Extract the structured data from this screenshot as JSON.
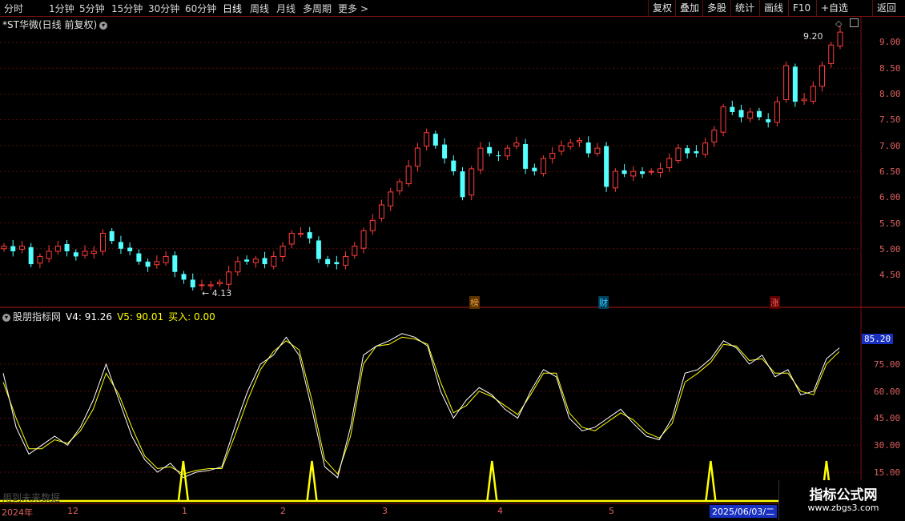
{
  "toolbar": {
    "periods": [
      "分时",
      "1分钟",
      "5分钟",
      "15分钟",
      "30分钟",
      "60分钟",
      "日线",
      "周线",
      "月线",
      "多周期",
      "更多 >"
    ],
    "active_period": "日线",
    "right_buttons": [
      "复权",
      "叠加",
      "多股",
      "统计",
      "画线",
      "F10",
      "+自选",
      "返回"
    ]
  },
  "stock": {
    "title": "*ST华微(日线 前复权)",
    "high_label": "9.20",
    "low_label": "4.13"
  },
  "indicator": {
    "name": "股朋指标网",
    "v4": "V4: 91.26",
    "v5": "V5: 90.01",
    "buy": "买入: 0.00",
    "current_value": "85.20"
  },
  "price_axis": [
    "9.00",
    "8.50",
    "8.00",
    "7.50",
    "7.00",
    "6.50",
    "6.00",
    "5.50",
    "5.00",
    "4.50"
  ],
  "indicator_axis": [
    "75.00",
    "60.00",
    "45.00",
    "30.00",
    "15.00"
  ],
  "date_axis": {
    "year": "2024年",
    "months": [
      "12",
      "1",
      "2",
      "3",
      "4",
      "5"
    ],
    "selected_date": "2025/06/03/二"
  },
  "event_tags": [
    {
      "text": "榜",
      "color": "#e8a040"
    },
    {
      "text": "财",
      "color": "#40c8ff"
    },
    {
      "text": "涨",
      "color": "#ff6060"
    }
  ],
  "future_label": "用到未来数据",
  "watermark": {
    "title": "指标公式网",
    "url": "www.zbgs3.com"
  },
  "colors": {
    "up": "#ff3c3c",
    "down": "#54ffff",
    "v4_line": "#ffffff",
    "v5_line": "#ffff00",
    "grid": "#5a0c0c"
  },
  "chart_data": [
    {
      "type": "candlestick",
      "title": "*ST华微(日线 前复权)",
      "ylim": [
        4.1,
        9.3
      ],
      "close_approx": [
        5.05,
        4.95,
        5.05,
        4.7,
        4.85,
        4.95,
        5.05,
        4.95,
        4.85,
        4.95,
        4.95,
        5.3,
        5.15,
        5.0,
        4.95,
        4.75,
        4.65,
        4.75,
        4.85,
        4.55,
        4.4,
        4.25,
        4.3,
        4.3,
        4.35,
        4.55,
        4.75,
        4.75,
        4.8,
        4.7,
        4.85,
        5.05,
        5.3,
        5.3,
        5.2,
        4.8,
        4.7,
        4.7,
        4.85,
        5.05,
        5.35,
        5.55,
        5.85,
        6.1,
        6.3,
        6.6,
        6.95,
        7.25,
        7.0,
        6.75,
        6.5,
        6.0,
        6.55,
        6.95,
        6.85,
        6.8,
        6.95,
        7.05,
        6.55,
        6.5,
        6.75,
        6.85,
        7.0,
        7.05,
        7.1,
        6.85,
        6.95,
        6.2,
        6.5,
        6.45,
        6.5,
        6.45,
        6.5,
        6.55,
        6.75,
        6.95,
        6.85,
        6.85,
        7.05,
        7.3,
        7.75,
        7.65,
        7.55,
        7.65,
        7.55,
        7.45,
        7.85,
        8.55,
        7.85,
        7.9,
        8.15,
        8.55,
        8.95,
        9.2
      ]
    },
    {
      "type": "line",
      "title": "股朋指标网",
      "ylim": [
        7,
        95
      ],
      "series": [
        {
          "name": "V4",
          "values": [
            70,
            40,
            25,
            30,
            35,
            30,
            40,
            55,
            75,
            55,
            35,
            22,
            15,
            20,
            12,
            15,
            16,
            18,
            40,
            60,
            75,
            80,
            90,
            80,
            50,
            18,
            12,
            40,
            80,
            85,
            88,
            92,
            90,
            85,
            60,
            45,
            55,
            62,
            58,
            50,
            45,
            60,
            72,
            68,
            45,
            38,
            40,
            45,
            50,
            42,
            35,
            33,
            45,
            70,
            72,
            78,
            88,
            84,
            75,
            80,
            68,
            72,
            58,
            60,
            78,
            84
          ]
        },
        {
          "name": "V5",
          "values": [
            65,
            45,
            28,
            28,
            33,
            31,
            38,
            50,
            70,
            58,
            40,
            24,
            17,
            18,
            14,
            16,
            17,
            17,
            35,
            55,
            72,
            82,
            88,
            83,
            55,
            22,
            14,
            35,
            75,
            85,
            86,
            90,
            89,
            86,
            65,
            48,
            52,
            60,
            57,
            52,
            47,
            58,
            70,
            70,
            48,
            40,
            38,
            43,
            48,
            44,
            37,
            34,
            42,
            65,
            70,
            76,
            86,
            85,
            77,
            78,
            70,
            70,
            60,
            58,
            75,
            82
          ]
        },
        {
          "name": "买入",
          "spikes_at_index": [
            14,
            24,
            38,
            55,
            64
          ]
        }
      ]
    }
  ]
}
